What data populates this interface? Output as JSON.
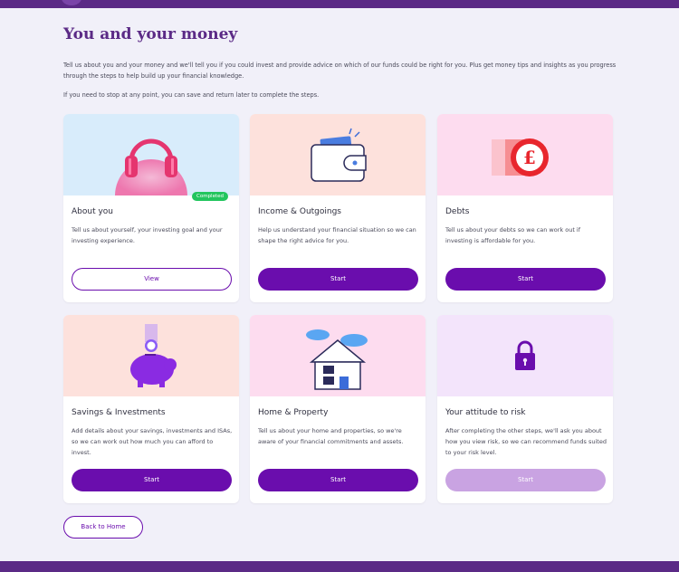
{
  "page": {
    "title": "You and your money",
    "intro": "Tell us about you and your money and we'll tell you if you could invest and provide advice on which of our funds could be right for you. Plus get money tips and insights as you progress through the steps to help build up your financial knowledge.",
    "intro2": "If you need to stop at any point, you can save and return later to complete the steps."
  },
  "cards": [
    {
      "title": "About you",
      "desc": "Tell us about yourself, your investing goal and your investing experience.",
      "button": "View",
      "badge": "Completed",
      "bg": "#d8ecfb",
      "icon": "headphones-icon"
    },
    {
      "title": "Income & Outgoings",
      "desc": "Help us understand your financial situation so we can shape the right advice for you.",
      "button": "Start",
      "bg": "#fde1dc",
      "icon": "wallet-icon"
    },
    {
      "title": "Debts",
      "desc": "Tell us about your debts so we can work out if investing is affordable for you.",
      "button": "Start",
      "bg": "#fddcef",
      "icon": "pound-coin-icon"
    },
    {
      "title": "Savings & Investments",
      "desc": "Add details about your savings, investments and ISAs, so we can work out how much you can afford to invest.",
      "button": "Start",
      "bg": "#fde1dc",
      "icon": "piggy-bank-icon"
    },
    {
      "title": "Home & Property",
      "desc": "Tell us about your home and properties, so we're aware of your financial commitments and assets.",
      "button": "Start",
      "bg": "#fddcef",
      "icon": "house-icon"
    },
    {
      "title": "Your attitude to risk",
      "desc": "After completing the other steps, we'll ask you about how you view risk, so we can recommend funds suited to your risk level.",
      "button": "Start",
      "bg": "#f3e4fb",
      "icon": "padlock-icon"
    }
  ],
  "footer": {
    "back_label": "Back to Home"
  },
  "colors": {
    "brand": "#5b2a86",
    "button": "#6a0dad",
    "button_disabled": "#c9a3e2",
    "completed": "#22c55e"
  }
}
